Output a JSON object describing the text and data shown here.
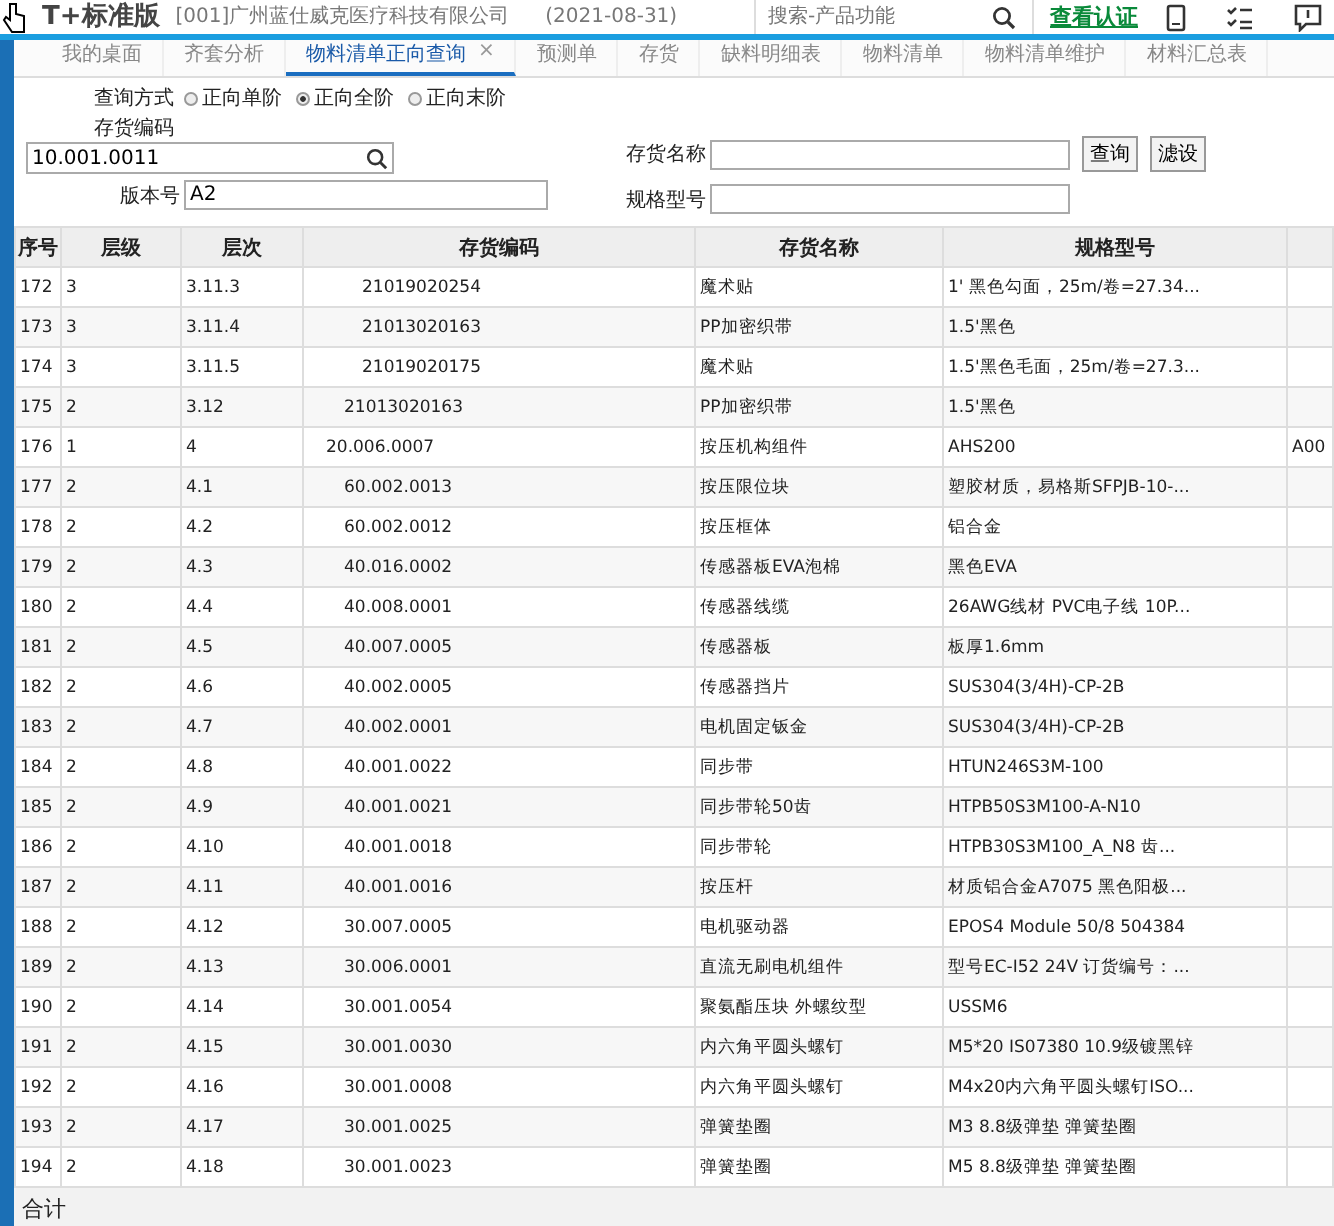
{
  "header": {
    "logo": "T+标准版",
    "company": "[001]广州蓝仕威克医疗科技有限公司",
    "date": "(2021-08-31)",
    "search": {
      "placeholder": "搜索-产品功能"
    },
    "link": "查看认证"
  },
  "tabs": [
    {
      "label": "我的桌面",
      "selected": false
    },
    {
      "label": "齐套分析",
      "selected": false
    },
    {
      "label": "物料清单正向查询",
      "selected": true,
      "close": "×"
    },
    {
      "label": "预测单",
      "selected": false
    },
    {
      "label": "存货",
      "selected": false
    },
    {
      "label": "缺料明细表",
      "selected": false
    },
    {
      "label": "物料清单",
      "selected": false
    },
    {
      "label": "物料清单维护",
      "selected": false
    },
    {
      "label": "材料汇总表",
      "selected": false
    }
  ],
  "query": {
    "mode_label": "查询方式",
    "modes": [
      {
        "label": "正向单阶",
        "selected": false
      },
      {
        "label": "正向全阶",
        "selected": true
      },
      {
        "label": "正向末阶",
        "selected": false
      }
    ],
    "code_label": "存货编码",
    "code_value": "10.001.0011",
    "version_label": "版本号",
    "version_value": "A2",
    "name_label": "存货名称",
    "spec_label": "规格型号",
    "buttons": [
      "查询",
      "滤设"
    ]
  },
  "table": {
    "columns": [
      "序号",
      "层级",
      "层次",
      "存货编码",
      "存货名称",
      "规格型号"
    ],
    "rows": [
      [
        "172",
        "3",
        "3.11.3",
        "21019020254",
        "魔术贴",
        "1' 黑色勾面，25m/卷=27.34..."
      ],
      [
        "173",
        "3",
        "3.11.4",
        "21013020163",
        "PP加密织带",
        "1.5'黑色"
      ],
      [
        "174",
        "3",
        "3.11.5",
        "21019020175",
        "魔术贴",
        "1.5'黑色毛面，25m/卷=27.3..."
      ],
      [
        "175",
        "2",
        "3.12",
        "21013020163",
        "PP加密织带",
        "1.5'黑色"
      ],
      [
        "176",
        "1",
        "4",
        "20.006.0007",
        "按压机构组件",
        "AHS200",
        "A00"
      ],
      [
        "177",
        "2",
        "4.1",
        "60.002.0013",
        "按压限位块",
        "塑胶材质，易格斯SFPJB-10-..."
      ],
      [
        "178",
        "2",
        "4.2",
        "60.002.0012",
        "按压框体",
        "铝合金"
      ],
      [
        "179",
        "2",
        "4.3",
        "40.016.0002",
        "传感器板EVA泡棉",
        "黑色EVA"
      ],
      [
        "180",
        "2",
        "4.4",
        "40.008.0001",
        "传感器线缆",
        "26AWG线材 PVC电子线 10P..."
      ],
      [
        "181",
        "2",
        "4.5",
        "40.007.0005",
        "传感器板",
        "板厚1.6mm"
      ],
      [
        "182",
        "2",
        "4.6",
        "40.002.0005",
        "传感器挡片",
        "SUS304(3/4H)-CP-2B"
      ],
      [
        "183",
        "2",
        "4.7",
        "40.002.0001",
        "电机固定钣金",
        "SUS304(3/4H)-CP-2B"
      ],
      [
        "184",
        "2",
        "4.8",
        "40.001.0022",
        "同步带",
        "HTUN246S3M-100"
      ],
      [
        "185",
        "2",
        "4.9",
        "40.001.0021",
        "同步带轮50齿",
        "HTPB50S3M100-A-N10"
      ],
      [
        "186",
        "2",
        "4.10",
        "40.001.0018",
        "同步带轮",
        "HTPB30S3M100_A_N8 齿..."
      ],
      [
        "187",
        "2",
        "4.11",
        "40.001.0016",
        "按压杆",
        "材质铝合金A7075 黑色阳极..."
      ],
      [
        "188",
        "2",
        "4.12",
        "30.007.0005",
        "电机驱动器",
        "EPOS4 Module 50/8  504384"
      ],
      [
        "189",
        "2",
        "4.13",
        "30.006.0001",
        "直流无刷电机组件",
        "型号EC-I52 24V 订货编号：..."
      ],
      [
        "190",
        "2",
        "4.14",
        "30.001.0054",
        "聚氨酯压块 外螺纹型",
        "USSM6"
      ],
      [
        "191",
        "2",
        "4.15",
        "30.001.0030",
        "内六角平圆头螺钉",
        "M5*20 IS07380 10.9级镀黑锌"
      ],
      [
        "192",
        "2",
        "4.16",
        "30.001.0008",
        "内六角平圆头螺钉",
        "M4x20内六角平圆头螺钉ISO..."
      ],
      [
        "193",
        "2",
        "4.17",
        "30.001.0025",
        "弹簧垫圈",
        "M3 8.8级弹垫 弹簧垫圈"
      ],
      [
        "194",
        "2",
        "4.18",
        "30.001.0023",
        "弹簧垫圈",
        "M5 8.8级弹垫 弹簧垫圈"
      ]
    ],
    "footer": "合计"
  }
}
